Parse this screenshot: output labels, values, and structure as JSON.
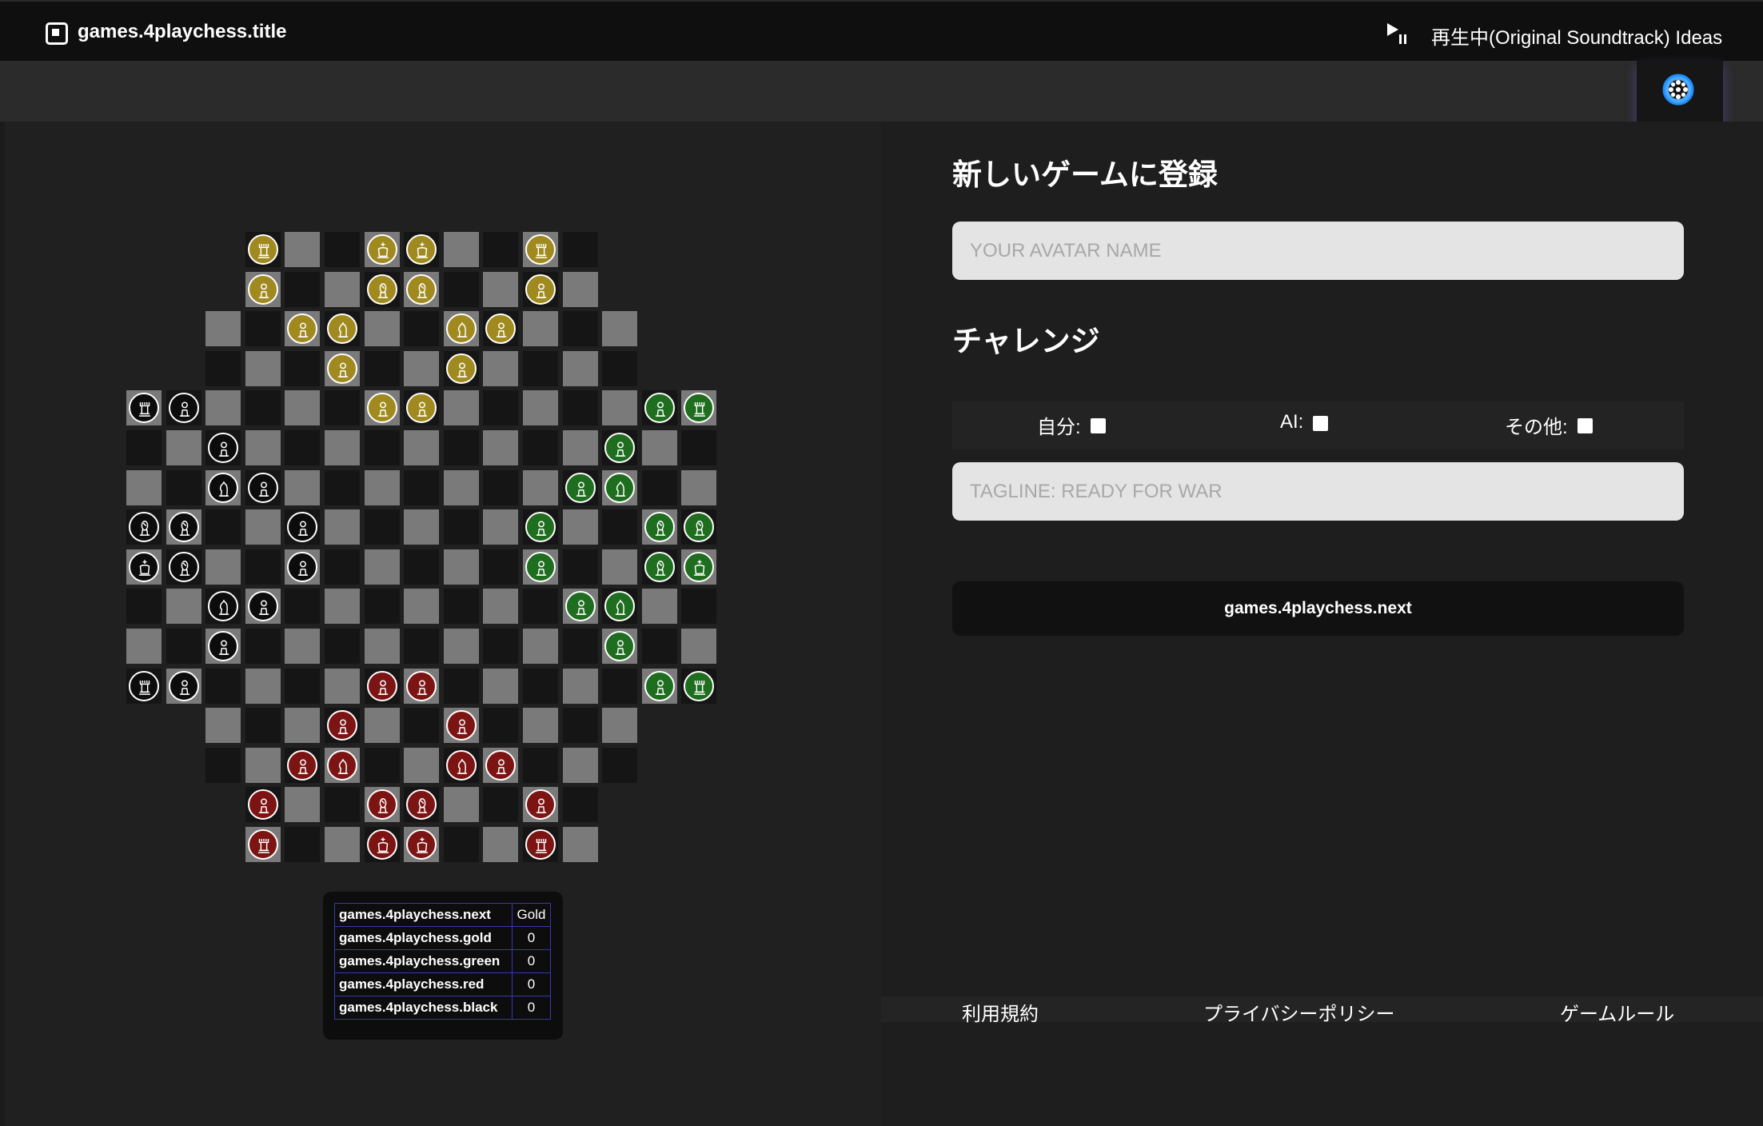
{
  "header": {
    "app_icon": "app-square-icon",
    "title": "games.4playchess.title",
    "play_icon": "play-pause-icon",
    "now_playing": "再生中(Original Soundtrack) Ideas"
  },
  "settings": {
    "icon": "gear-icon",
    "accent": "#1e90ff"
  },
  "board": {
    "colors": {
      "light_square": "#7a7a7a",
      "dark_square": "#151515",
      "gold": "#a08a20",
      "green": "#1f6d1f",
      "red": "#7c1414",
      "black": "#0c0c0c"
    },
    "pieces": [
      {
        "color": "gold",
        "type": "rook",
        "square": "D1"
      },
      {
        "color": "gold",
        "type": "king",
        "square": "G1"
      },
      {
        "color": "gold",
        "type": "king",
        "square": "H1"
      },
      {
        "color": "gold",
        "type": "rook",
        "square": "K1"
      },
      {
        "color": "gold",
        "type": "pawn",
        "square": "D2"
      },
      {
        "color": "gold",
        "type": "bishop",
        "square": "G2"
      },
      {
        "color": "gold",
        "type": "bishop",
        "square": "H2"
      },
      {
        "color": "gold",
        "type": "pawn",
        "square": "K2"
      },
      {
        "color": "gold",
        "type": "pawn",
        "square": "E3"
      },
      {
        "color": "gold",
        "type": "knight",
        "square": "F3"
      },
      {
        "color": "gold",
        "type": "knight",
        "square": "I3"
      },
      {
        "color": "gold",
        "type": "pawn",
        "square": "J3"
      },
      {
        "color": "gold",
        "type": "pawn",
        "square": "F4"
      },
      {
        "color": "gold",
        "type": "pawn",
        "square": "I4"
      },
      {
        "color": "gold",
        "type": "pawn",
        "square": "G5"
      },
      {
        "color": "gold",
        "type": "pawn",
        "square": "H5"
      },
      {
        "color": "black",
        "type": "rook",
        "square": "A5"
      },
      {
        "color": "black",
        "type": "pawn",
        "square": "B5"
      },
      {
        "color": "black",
        "type": "pawn",
        "square": "C6"
      },
      {
        "color": "black",
        "type": "knight",
        "square": "C7"
      },
      {
        "color": "black",
        "type": "pawn",
        "square": "D7"
      },
      {
        "color": "black",
        "type": "bishop",
        "square": "A8"
      },
      {
        "color": "black",
        "type": "bishop",
        "square": "B8"
      },
      {
        "color": "black",
        "type": "pawn",
        "square": "E8"
      },
      {
        "color": "black",
        "type": "king",
        "square": "A9"
      },
      {
        "color": "black",
        "type": "bishop",
        "square": "B9"
      },
      {
        "color": "black",
        "type": "pawn",
        "square": "E9"
      },
      {
        "color": "black",
        "type": "knight",
        "square": "C10"
      },
      {
        "color": "black",
        "type": "pawn",
        "square": "D10"
      },
      {
        "color": "black",
        "type": "pawn",
        "square": "C11"
      },
      {
        "color": "black",
        "type": "rook",
        "square": "A12"
      },
      {
        "color": "black",
        "type": "pawn",
        "square": "B12"
      },
      {
        "color": "green",
        "type": "pawn",
        "square": "N5"
      },
      {
        "color": "green",
        "type": "rook",
        "square": "O5"
      },
      {
        "color": "green",
        "type": "pawn",
        "square": "M6"
      },
      {
        "color": "green",
        "type": "pawn",
        "square": "L7"
      },
      {
        "color": "green",
        "type": "knight",
        "square": "M7"
      },
      {
        "color": "green",
        "type": "pawn",
        "square": "K8"
      },
      {
        "color": "green",
        "type": "bishop",
        "square": "N8"
      },
      {
        "color": "green",
        "type": "bishop",
        "square": "O8"
      },
      {
        "color": "green",
        "type": "pawn",
        "square": "K9"
      },
      {
        "color": "green",
        "type": "bishop",
        "square": "N9"
      },
      {
        "color": "green",
        "type": "king",
        "square": "O9"
      },
      {
        "color": "green",
        "type": "pawn",
        "square": "L10"
      },
      {
        "color": "green",
        "type": "knight",
        "square": "M10"
      },
      {
        "color": "green",
        "type": "pawn",
        "square": "M11"
      },
      {
        "color": "green",
        "type": "pawn",
        "square": "N12"
      },
      {
        "color": "green",
        "type": "rook",
        "square": "O12"
      },
      {
        "color": "red",
        "type": "pawn",
        "square": "G12"
      },
      {
        "color": "red",
        "type": "pawn",
        "square": "H12"
      },
      {
        "color": "red",
        "type": "pawn",
        "square": "F13"
      },
      {
        "color": "red",
        "type": "pawn",
        "square": "I13"
      },
      {
        "color": "red",
        "type": "pawn",
        "square": "E14"
      },
      {
        "color": "red",
        "type": "knight",
        "square": "F14"
      },
      {
        "color": "red",
        "type": "knight",
        "square": "I14"
      },
      {
        "color": "red",
        "type": "pawn",
        "square": "J14"
      },
      {
        "color": "red",
        "type": "pawn",
        "square": "D15"
      },
      {
        "color": "red",
        "type": "bishop",
        "square": "G15"
      },
      {
        "color": "red",
        "type": "bishop",
        "square": "H15"
      },
      {
        "color": "red",
        "type": "pawn",
        "square": "K15"
      },
      {
        "color": "red",
        "type": "rook",
        "square": "D16"
      },
      {
        "color": "red",
        "type": "king",
        "square": "G16"
      },
      {
        "color": "red",
        "type": "king",
        "square": "H16"
      },
      {
        "color": "red",
        "type": "rook",
        "square": "K16"
      }
    ]
  },
  "scores": {
    "header": {
      "label": "games.4playchess.next",
      "value": "Gold"
    },
    "rows": [
      {
        "label": "games.4playchess.gold",
        "value": "0"
      },
      {
        "label": "games.4playchess.green",
        "value": "0"
      },
      {
        "label": "games.4playchess.red",
        "value": "0"
      },
      {
        "label": "games.4playchess.black",
        "value": "0"
      }
    ]
  },
  "form": {
    "register_heading": "新しいゲームに登録",
    "avatar_placeholder": "YOUR AVATAR NAME",
    "avatar_value": "",
    "challenge_heading": "チャレンジ",
    "options": [
      {
        "label": "自分:",
        "checked": false
      },
      {
        "label": "AI:",
        "checked": false
      },
      {
        "label": "その他:",
        "checked": false
      }
    ],
    "tagline_placeholder": "TAGLINE: READY FOR WAR",
    "tagline_value": "",
    "next_button": "games.4playchess.next"
  },
  "footer": {
    "terms": "利用規約",
    "privacy": "プライバシーポリシー",
    "rules": "ゲームルール"
  }
}
